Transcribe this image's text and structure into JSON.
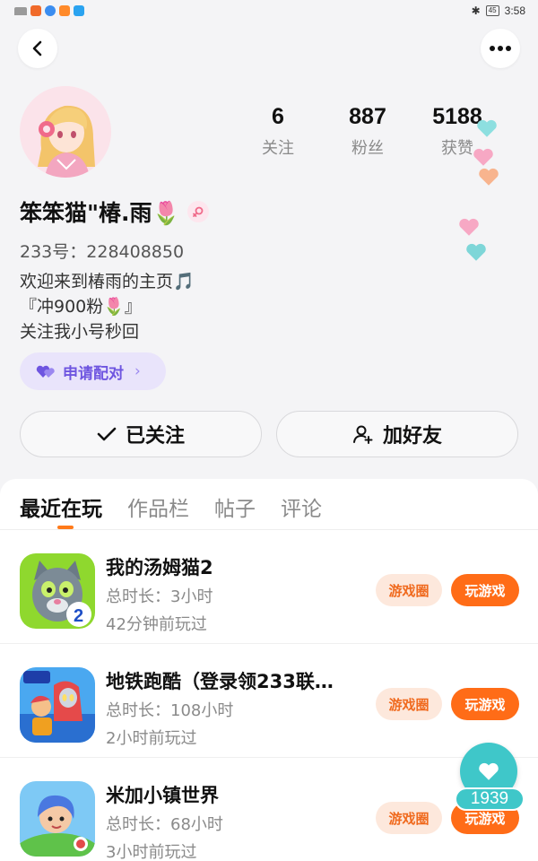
{
  "status_bar": {
    "time": "3:58",
    "battery": "45"
  },
  "profile": {
    "name": "笨笨猫\"椿.雨🌷",
    "uid": "233号：228408850",
    "bio": [
      "欢迎来到椿雨的主页🎵",
      "『冲900粉🌷』",
      "关注我小号秒回"
    ],
    "pair_label": "申请配对",
    "stats": [
      {
        "value": "6",
        "label": "关注"
      },
      {
        "value": "887",
        "label": "粉丝"
      },
      {
        "value": "5188",
        "label": "获赞"
      }
    ]
  },
  "actions": {
    "follow_label": "已关注",
    "add_friend_label": "加好友"
  },
  "tabs": [
    "最近在玩",
    "作品栏",
    "帖子",
    "评论"
  ],
  "games": [
    {
      "title": "我的汤姆猫2",
      "duration": "总时长：3小时",
      "last_played": "42分钟前玩过",
      "circle_label": "游戏圈",
      "play_label": "玩游戏"
    },
    {
      "title": "地铁跑酷（登录领233联…",
      "duration": "总时长：108小时",
      "last_played": "2小时前玩过",
      "circle_label": "游戏圈",
      "play_label": "玩游戏"
    },
    {
      "title": "米加小镇世界",
      "duration": "总时长：68小时",
      "last_played": "3小时前玩过",
      "circle_label": "游戏圈",
      "play_label": "玩游戏"
    }
  ],
  "like_count": "1939",
  "colors": {
    "accent": "#ff6c17",
    "like": "#3fc7c9",
    "pair": "#6e55e0"
  }
}
